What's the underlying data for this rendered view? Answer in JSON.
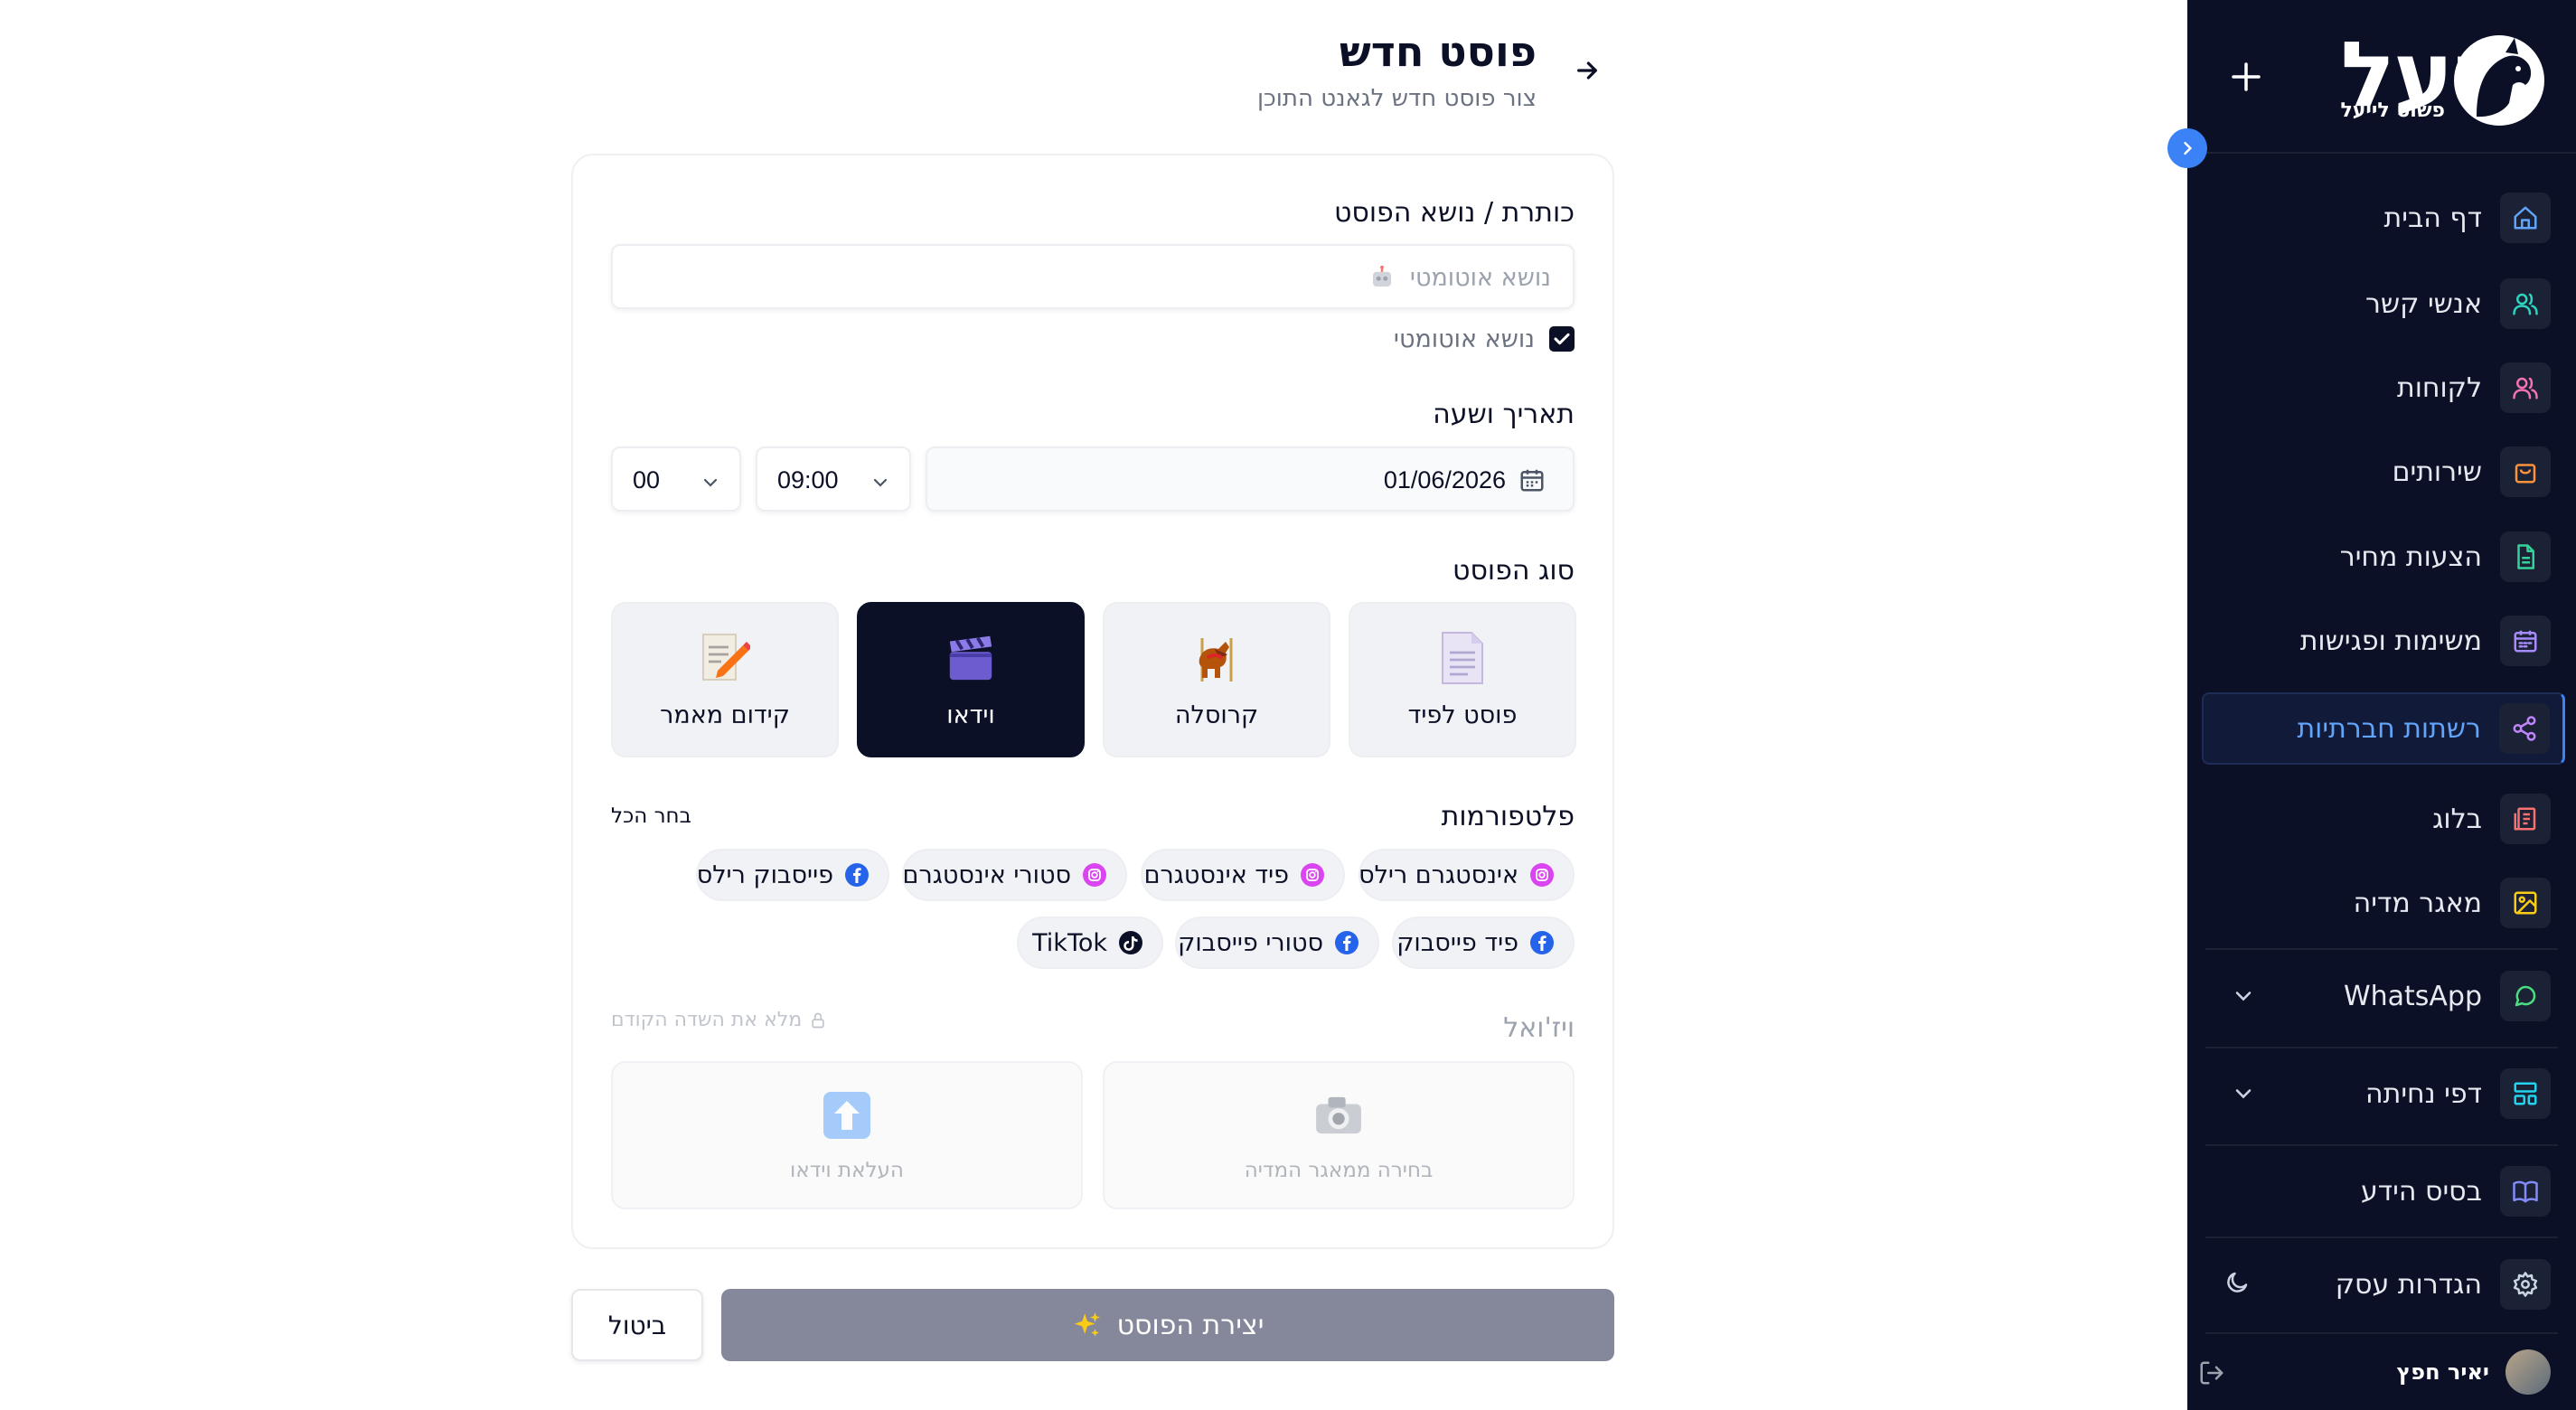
{
  "header": {
    "title": "פוסט חדש",
    "subtitle": "צור פוסט חדש לגאנט התוכן"
  },
  "sidebar": {
    "logo_text": "יעל",
    "logo_tagline": "פשוט לייעל",
    "items": [
      {
        "label": "דף הבית",
        "icon": "home-icon",
        "color": "#60a5fa"
      },
      {
        "label": "אנשי קשר",
        "icon": "users-icon",
        "color": "#2dd4bf"
      },
      {
        "label": "לקוחות",
        "icon": "customers-icon",
        "color": "#f472b6"
      },
      {
        "label": "שירותים",
        "icon": "shopping-bag-icon",
        "color": "#fb923c"
      },
      {
        "label": "הצעות מחיר",
        "icon": "document-icon",
        "color": "#34d399"
      },
      {
        "label": "משימות ופגישות",
        "icon": "calendar-icon",
        "color": "#a78bfa"
      },
      {
        "label": "רשתות חברתיות",
        "icon": "share-icon",
        "color": "#c084fc"
      },
      {
        "label": "בלוג",
        "icon": "blog-icon",
        "color": "#f87171"
      },
      {
        "label": "מאגר מדיה",
        "icon": "image-icon",
        "color": "#facc15"
      },
      {
        "label": "WhatsApp",
        "icon": "whatsapp-icon",
        "color": "#4ade80"
      },
      {
        "label": "דפי נחיתה",
        "icon": "layout-icon",
        "color": "#22d3ee"
      },
      {
        "label": "בסיס הידע",
        "icon": "book-icon",
        "color": "#818cf8"
      },
      {
        "label": "הגדרות עסק",
        "icon": "gear-icon",
        "color": "#cbd5e1"
      }
    ],
    "active_item": "רשתות חברתיות",
    "user_name": "יאיר חפץ"
  },
  "form": {
    "topic_label": "כותרת / נושא הפוסט",
    "topic_placeholder": "נושא אוטומטי",
    "auto_topic_label": "נושא אוטומטי",
    "auto_topic_checked": true,
    "datetime_label": "תאריך ושעה",
    "date_value": "01/06/2026",
    "time_value": "09:00",
    "minutes_value": "00",
    "post_type_label": "סוג הפוסט",
    "post_types": [
      {
        "label": "פוסט לפיד",
        "emoji": "page-icon"
      },
      {
        "label": "קרוסלה",
        "emoji": "carousel-horse-icon"
      },
      {
        "label": "וידאו",
        "emoji": "clapper-icon"
      },
      {
        "label": "קידום מאמר",
        "emoji": "memo-icon"
      }
    ],
    "selected_type": "וידאו",
    "platforms_label": "פלטפורמות",
    "select_all": "בחר הכל",
    "platforms": [
      {
        "label": "אינסטגרם רילס",
        "network": "instagram"
      },
      {
        "label": "פיד אינסטגרם",
        "network": "instagram"
      },
      {
        "label": "סטורי אינסטגרם",
        "network": "instagram"
      },
      {
        "label": "פייסבוק רילס",
        "network": "facebook"
      },
      {
        "label": "פיד פייסבוק",
        "network": "facebook"
      },
      {
        "label": "סטורי פייסבוק",
        "network": "facebook"
      },
      {
        "label": "TikTok",
        "network": "tiktok"
      }
    ],
    "visual_label": "ויז'ואל",
    "fill_previous": "מלא את השדה הקודם",
    "media_library_label": "בחירה ממאגר המדיה",
    "upload_video_label": "העלאת וידאו"
  },
  "actions": {
    "create_label": "יצירת הפוסט",
    "cancel_label": "ביטול"
  },
  "colors": {
    "sidebar_bg": "#0b1026",
    "accent": "#3b82f6",
    "instagram": "#d946ef",
    "facebook": "#2563eb",
    "create_button": "#85889a"
  }
}
